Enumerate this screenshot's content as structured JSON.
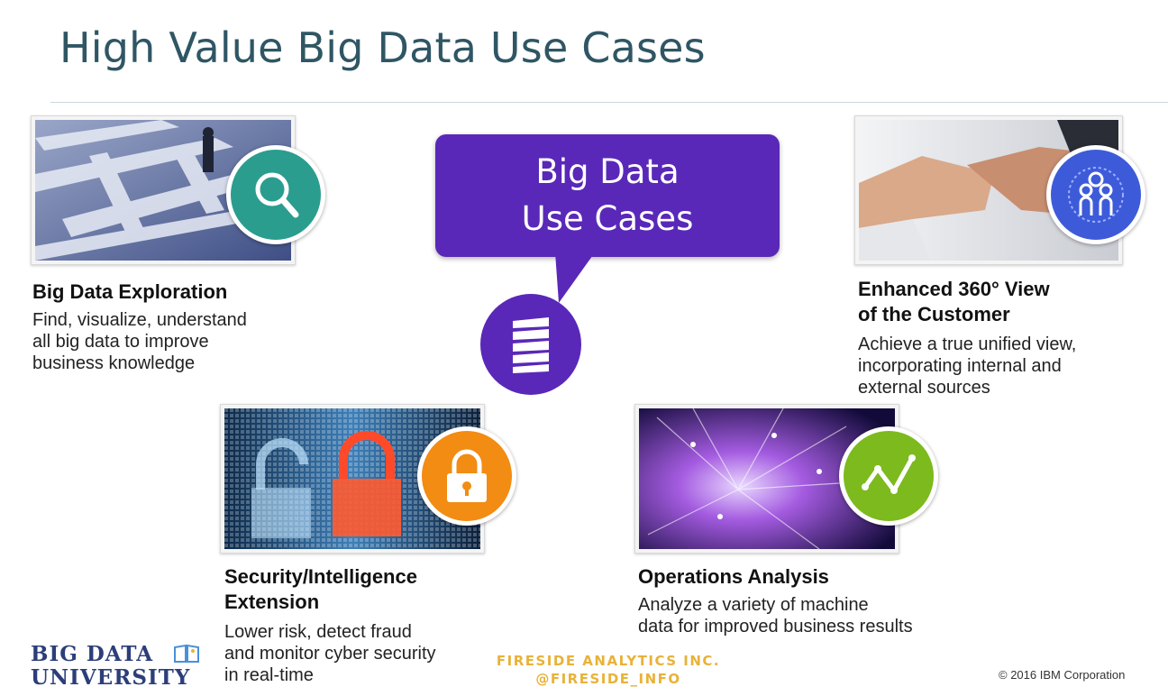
{
  "slide": {
    "title": "High Value Big Data Use Cases",
    "callout": {
      "line1": "Big Data",
      "line2": "Use Cases"
    }
  },
  "use_cases": [
    {
      "title": "Big Data Exploration",
      "description": [
        "Find, visualize, understand",
        "all big data to improve",
        "business knowledge"
      ],
      "icon": "magnifier-icon",
      "badge_color": "#2a9d8f"
    },
    {
      "title_lines": [
        "Enhanced 360° View",
        "of the Customer"
      ],
      "description": [
        "Achieve a true unified view,",
        "incorporating internal and",
        "external sources"
      ],
      "icon": "people-icon",
      "badge_color": "#3d5bd9"
    },
    {
      "title_lines": [
        "Security/Intelligence",
        "Extension"
      ],
      "description": [
        "Lower risk, detect fraud",
        "and monitor cyber security",
        "in real-time"
      ],
      "icon": "lock-icon",
      "badge_color": "#f28c12"
    },
    {
      "title": "Operations Analysis",
      "description": [
        "Analyze a variety of machine",
        "data for improved business results"
      ],
      "icon": "trend-line-icon",
      "badge_color": "#7cba1e"
    }
  ],
  "footer": {
    "logo_line1": "BIG DATA",
    "logo_line2": "UNIVERSITY",
    "company": "FIRESIDE ANALYTICS INC.",
    "handle": "@FIRESIDE_INFO",
    "copyright": "© 2016 IBM Corporation"
  },
  "colors": {
    "title": "#2f5664",
    "callout": "#5a28b8",
    "footer_accent": "#e8b23a"
  }
}
